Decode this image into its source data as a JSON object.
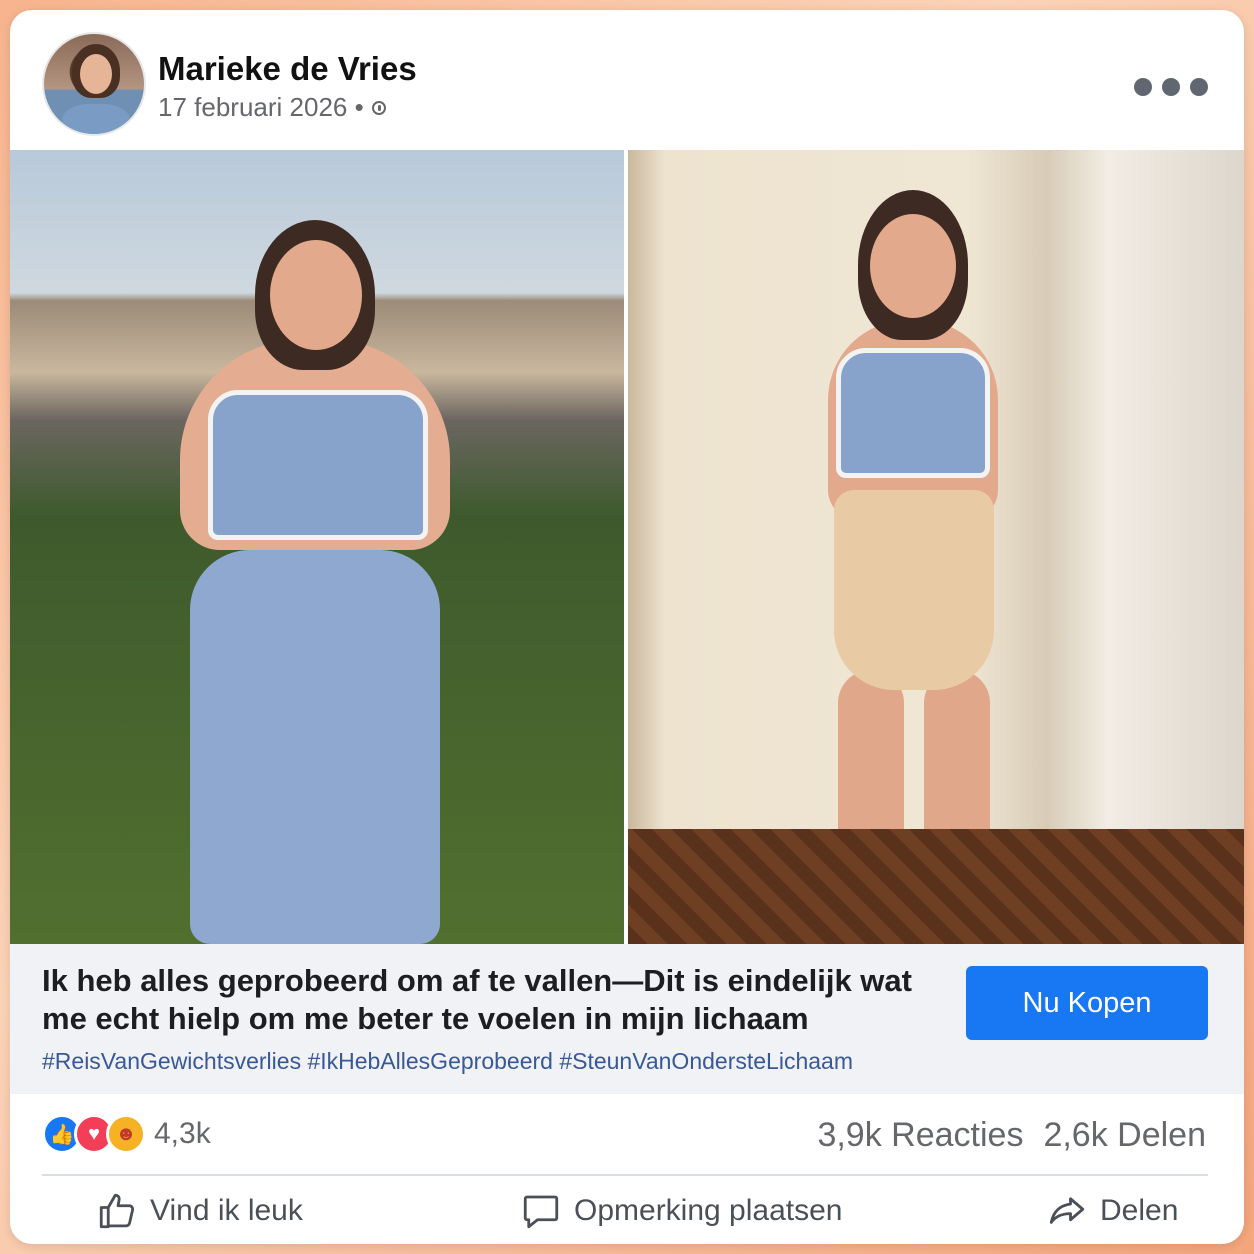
{
  "post": {
    "author": "Marieke de Vries",
    "date": "17 februari 2026 •",
    "headline": "Ik heb alles geprobeerd om af te vallen—Dit is eindelijk wat me echt hielp om me beter te voelen in mijn lichaam",
    "cta_label": "Nu Kopen",
    "hashtags": "#ReisVanGewichtsverlies #IkHebAllesGeprobeerd #SteunVanOndersteLichaam"
  },
  "stats": {
    "reaction_count": "4,3k",
    "comments": "3,9k Reacties",
    "shares": "2,6k Delen"
  },
  "actions": {
    "like": "Vind ik leuk",
    "comment": "Opmerking plaatsen",
    "share": "Delen"
  },
  "colors": {
    "accent": "#1877f2",
    "hashtag": "#385898",
    "muted": "#65676b"
  },
  "icons": [
    "globe-icon",
    "more-icon",
    "like-reaction-icon",
    "love-reaction-icon",
    "care-reaction-icon",
    "thumbs-up-icon",
    "comment-icon",
    "share-icon"
  ]
}
